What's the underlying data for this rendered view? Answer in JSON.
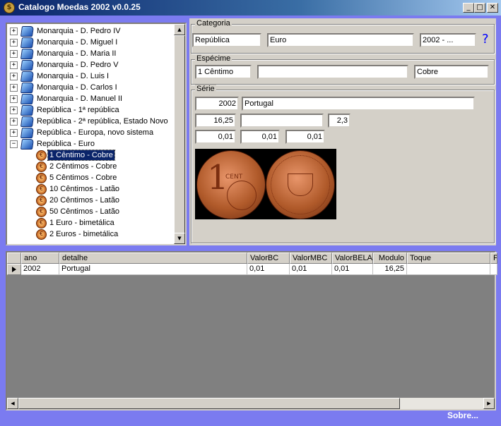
{
  "window": {
    "title": "Catalogo Moedas 2002  v0.0.25",
    "app_icon": "coin-icon",
    "icon_glyph": "$",
    "controls": {
      "minimize": "_",
      "maximize": "□",
      "close": "✕"
    }
  },
  "tree": {
    "expanded_glyph": "−",
    "collapsed_glyph": "+",
    "coin_glyph": "€",
    "items": [
      {
        "label": "Monarquia - D. Pedro IV",
        "icon": "book-icon",
        "expander": "+"
      },
      {
        "label": "Monarquia - D. Miguel I",
        "icon": "book-icon",
        "expander": "+"
      },
      {
        "label": "Monarquia - D. Maria II",
        "icon": "book-icon",
        "expander": "+"
      },
      {
        "label": "Monarquia - D. Pedro V",
        "icon": "book-icon",
        "expander": "+"
      },
      {
        "label": "Monarquia - D. Luis I",
        "icon": "book-icon",
        "expander": "+"
      },
      {
        "label": "Monarquia - D. Carlos I",
        "icon": "book-icon",
        "expander": "+"
      },
      {
        "label": "Monarquia - D. Manuel II",
        "icon": "book-icon",
        "expander": "+"
      },
      {
        "label": "República - 1ª república",
        "icon": "book-icon",
        "expander": "+"
      },
      {
        "label": "República - 2ª república, Estado Novo",
        "icon": "book-icon",
        "expander": "+"
      },
      {
        "label": "República - Europa, novo sistema",
        "icon": "book-icon",
        "expander": "+"
      },
      {
        "label": "República - Euro",
        "icon": "book-icon",
        "expander": "−"
      }
    ],
    "children": [
      {
        "label": "1 Cêntimo - Cobre",
        "selected": true
      },
      {
        "label": "2 Cêntimos - Cobre"
      },
      {
        "label": "5 Cêntimos - Cobre"
      },
      {
        "label": "10 Cêntimos - Latão"
      },
      {
        "label": "20 Cêntimos - Latão"
      },
      {
        "label": "50 Cêntimos - Latão"
      },
      {
        "label": "1 Euro - bimetálica"
      },
      {
        "label": "2 Euros - bimetálica"
      }
    ]
  },
  "categoria": {
    "title": "Categoria",
    "field1": "República",
    "field2": "Euro",
    "field3": "2002 - ...",
    "help": "?"
  },
  "especime": {
    "title": "Espécime",
    "field1": "1 Cêntimo",
    "field2": "",
    "field3": "Cobre"
  },
  "serie": {
    "title": "Série",
    "ano": "2002",
    "pais": "Portugal",
    "modulo": "16,25",
    "campo": "",
    "peso": "2,3",
    "v1": "0,01",
    "v2": "0,01",
    "v3": "0,01",
    "coin_obverse_text": "1",
    "coin_obverse_sub": "CENT"
  },
  "grid": {
    "columns": [
      "ano",
      "detalhe",
      "ValorBC",
      "ValorMBC",
      "ValorBELA",
      "Modulo",
      "Toque",
      "P"
    ],
    "rows": [
      [
        "2002",
        "Portugal",
        "0,01",
        "0,01",
        "0,01",
        "16,25",
        "",
        ""
      ]
    ]
  },
  "scroll": {
    "up": "▲",
    "down": "▼",
    "left": "◀",
    "right": "▶"
  },
  "footer": {
    "sobre": "Sobre..."
  }
}
